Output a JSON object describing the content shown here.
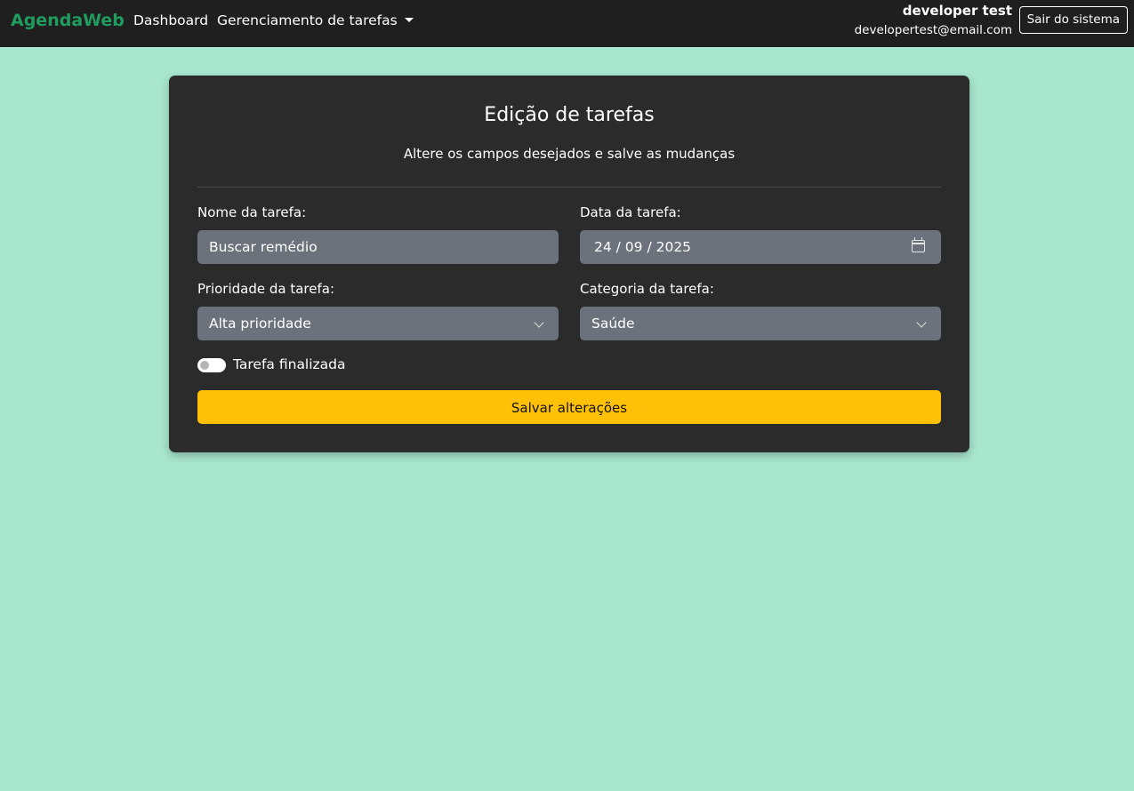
{
  "navbar": {
    "brand": "AgendaWeb",
    "links": {
      "dashboard": "Dashboard",
      "tasks": "Gerenciamento de tarefas"
    },
    "user": {
      "name": "developer test",
      "email": "developertest@email.com"
    },
    "logout_label": "Sair do sistema"
  },
  "form": {
    "title": "Edição de tarefas",
    "subtitle": "Altere os campos desejados e salve as mudanças",
    "name_label": "Nome da tarefa:",
    "name_value": "Buscar remédio",
    "date_label": "Data da tarefa:",
    "date_value": "24 / 09 / 2025",
    "priority_label": "Prioridade da tarefa:",
    "priority_value": "Alta prioridade",
    "category_label": "Categoria da tarefa:",
    "category_value": "Saúde",
    "finished_label": "Tarefa finalizada",
    "finished": false,
    "save_label": "Salvar alterações"
  },
  "colors": {
    "background": "#a8e6cf",
    "navbar": "#1f1f1f",
    "brand": "#1f9c5e",
    "card": "#2b2b2b",
    "input": "#6c727b",
    "save_button": "#ffc107"
  },
  "icons": {
    "date_picker": "calendar-icon",
    "select": "chevron-down-icon",
    "dropdown": "caret-down-icon"
  }
}
